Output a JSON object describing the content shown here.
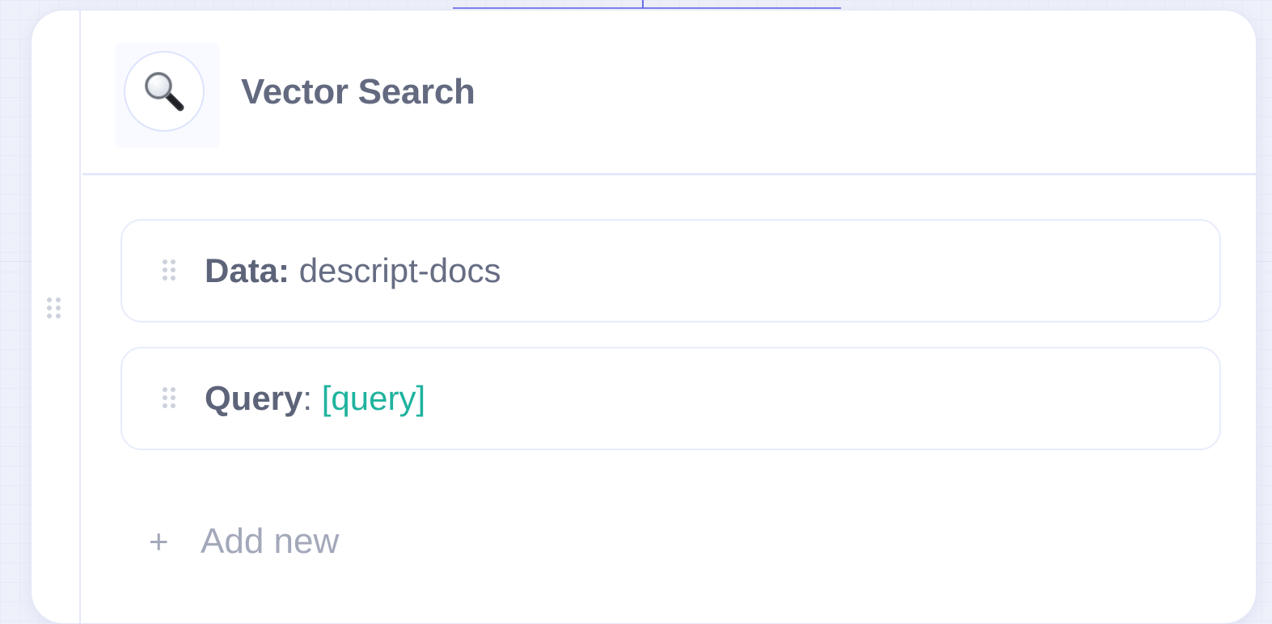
{
  "node": {
    "title": "Vector Search",
    "icon": "magnifying-glass-icon",
    "params": [
      {
        "key": "Data:",
        "sep": "",
        "value": " descript-docs",
        "value_type": "text"
      },
      {
        "key": "Query",
        "sep": ": ",
        "value": "[query]",
        "value_type": "variable"
      }
    ],
    "add_label": "Add new",
    "add_icon": "+"
  },
  "colors": {
    "edge": "#6b6ee8",
    "variable": "#1fb39e",
    "title": "#636a80",
    "muted": "#a3a8ba"
  }
}
